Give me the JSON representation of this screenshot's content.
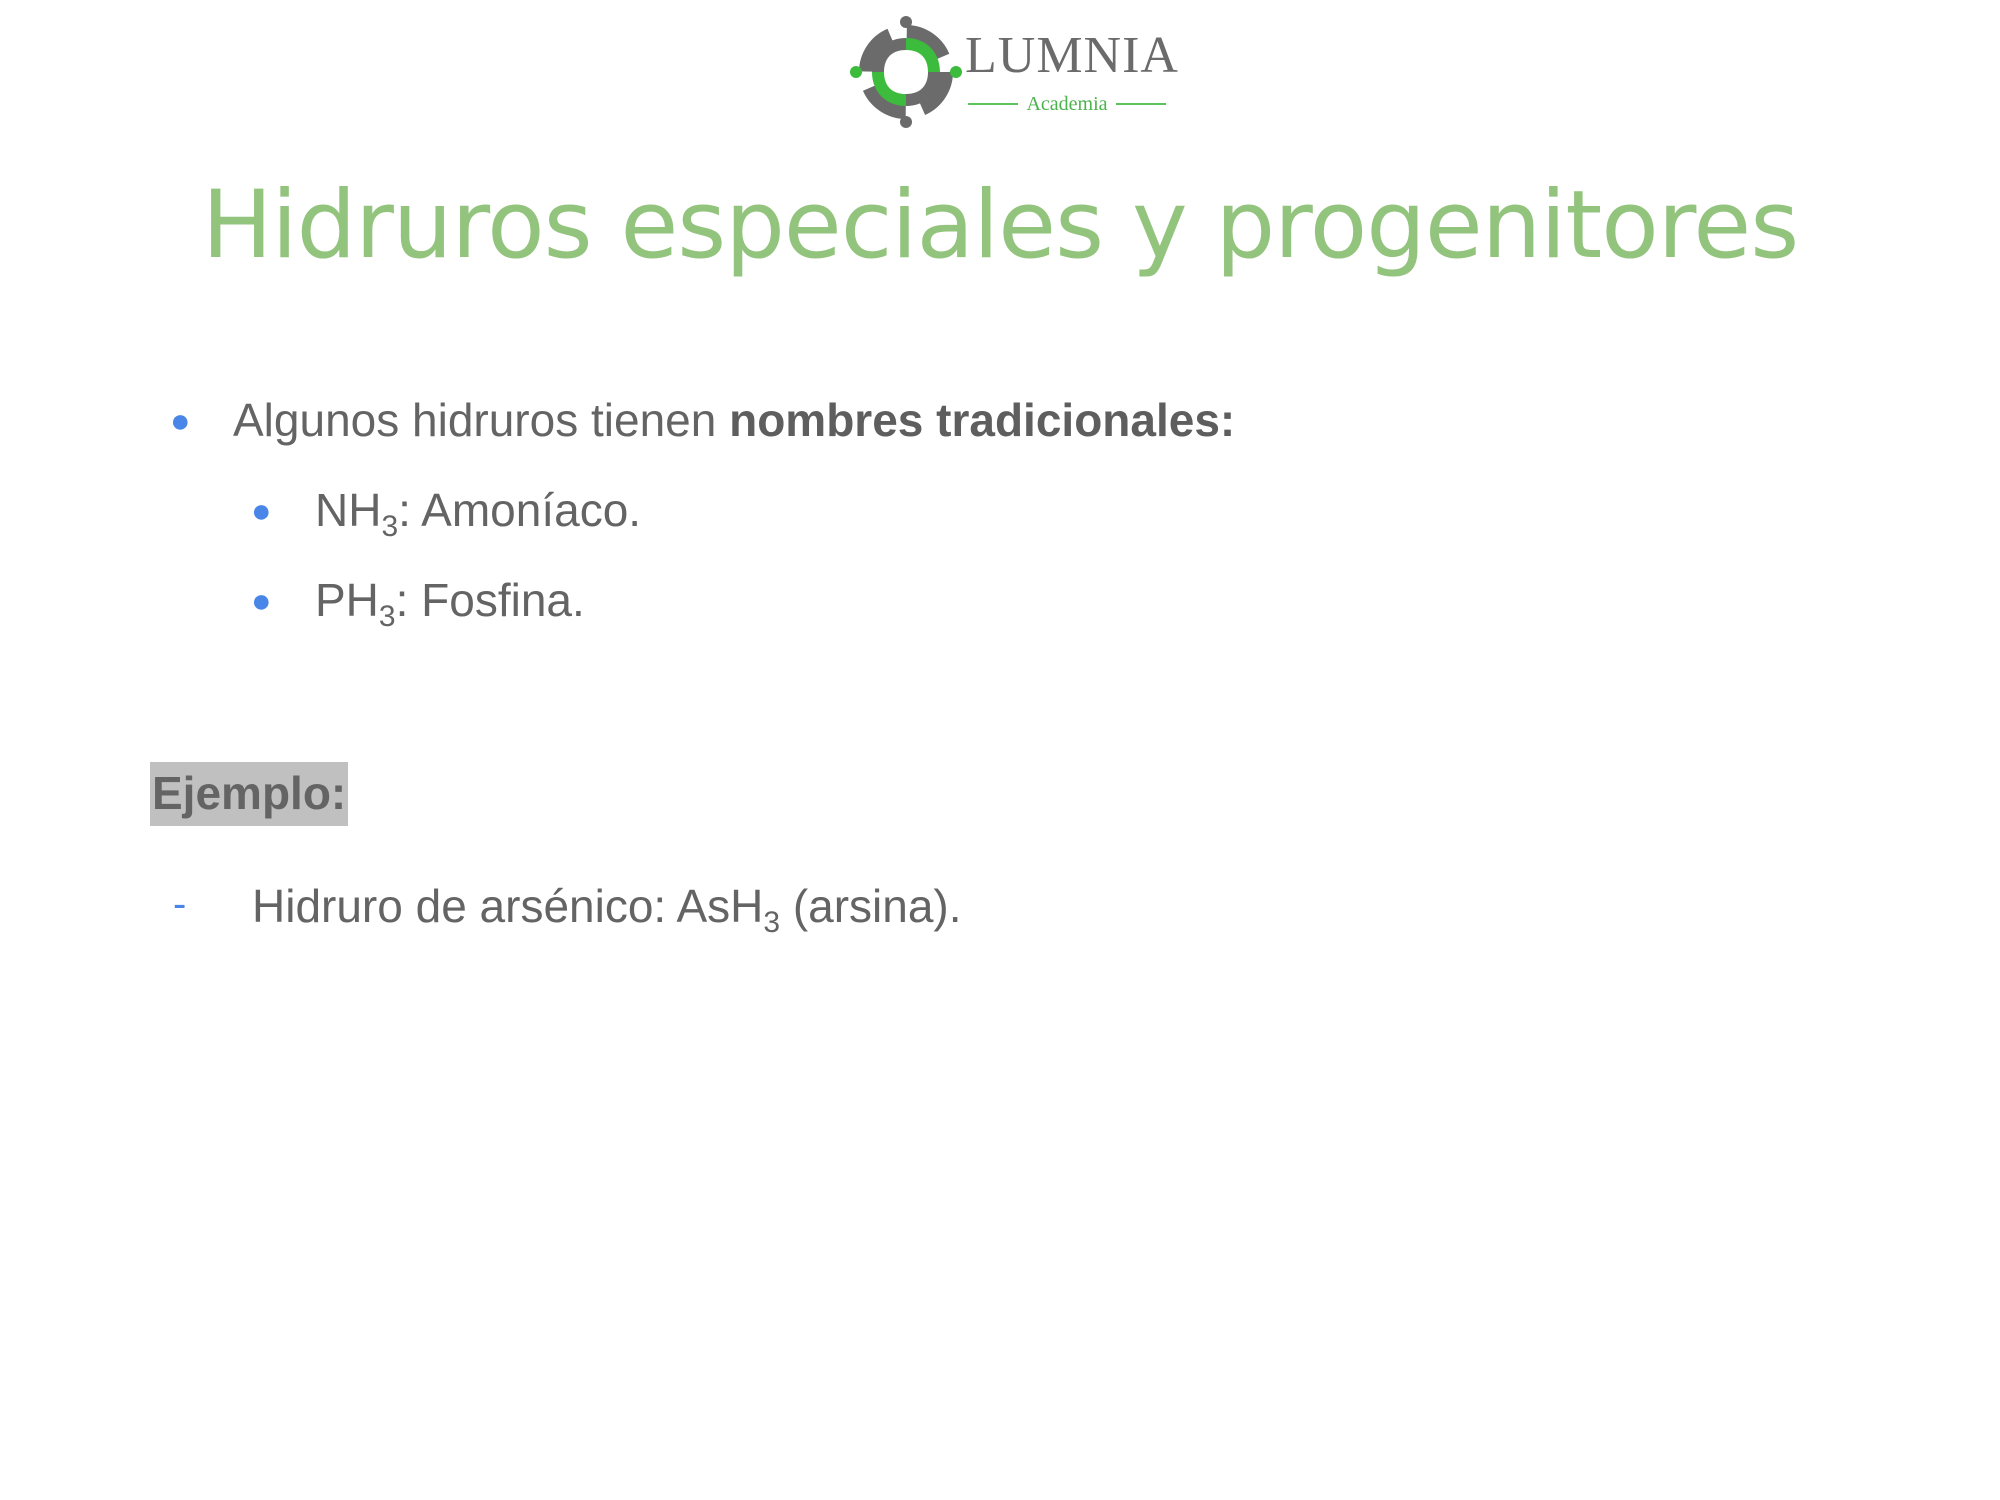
{
  "logo": {
    "name": "LUMNIA",
    "subtitle": "Academia",
    "colors": {
      "green": "#3dbb3d",
      "gray": "#6b6b6b"
    }
  },
  "title": "Hidruros especiales y progenitores",
  "intro": {
    "text": "Algunos hidruros tienen ",
    "bold": "nombres tradicionales:"
  },
  "items": [
    {
      "formula_base": "NH",
      "subscript": "3",
      "rest": ": Amoníaco."
    },
    {
      "formula_base": "PH",
      "subscript": "3",
      "rest": ": Fosfina."
    }
  ],
  "example": {
    "label": "Ejemplo:",
    "line_before": "Hidruro de arsénico: AsH",
    "line_sub": "3",
    "line_after": " (arsina)."
  },
  "colors": {
    "title": "#93c47d",
    "text": "#646464",
    "bullet": "#4a86e8",
    "highlight": "#c0c0c0"
  }
}
